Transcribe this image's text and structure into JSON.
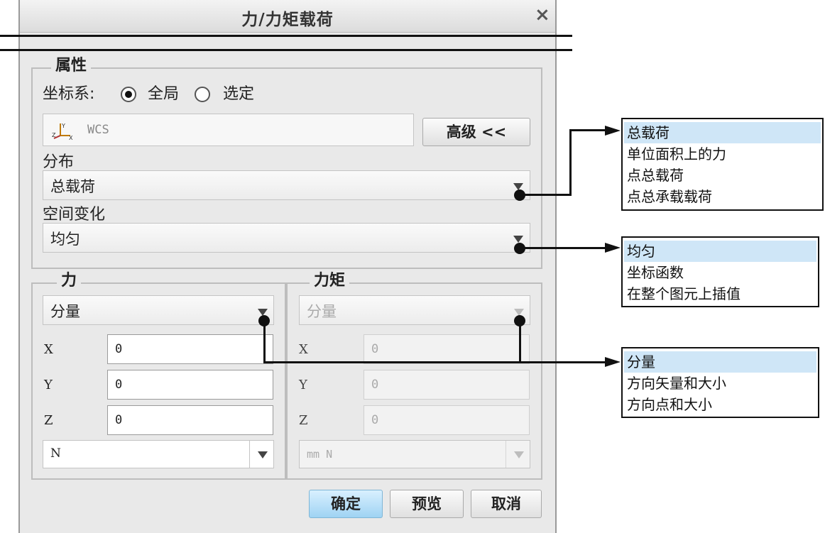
{
  "dialog": {
    "title": "力/力矩载荷",
    "close_glyph": "×",
    "properties": {
      "group_label": "属性",
      "coord_label": "坐标系:",
      "radio_global": "全局",
      "radio_selected": "选定",
      "coord_value": "WCS",
      "advanced_button": "高级 <<",
      "distribution_label": "分布",
      "distribution_value": "总载荷",
      "spatial_label": "空间变化",
      "spatial_value": "均匀"
    },
    "force": {
      "group_label": "力",
      "mode_value": "分量",
      "x_label": "X",
      "x_value": "0",
      "y_label": "Y",
      "y_value": "0",
      "z_label": "Z",
      "z_value": "0",
      "unit_value": "N"
    },
    "moment": {
      "group_label": "力矩",
      "mode_value": "分量",
      "x_label": "X",
      "x_value": "0",
      "y_label": "Y",
      "y_value": "0",
      "z_label": "Z",
      "z_value": "0",
      "unit_value": "mm N"
    },
    "buttons": {
      "ok": "确定",
      "preview": "预览",
      "cancel": "取消"
    }
  },
  "callouts": {
    "distribution_options": [
      "总载荷",
      "单位面积上的力",
      "点总载荷",
      "点总承载载荷"
    ],
    "spatial_options": [
      "均匀",
      "坐标函数",
      "在整个图元上插值"
    ],
    "component_options": [
      "分量",
      "方向矢量和大小",
      "方向点和大小"
    ]
  },
  "colors": {
    "dialog_bg": "#e9e9e9",
    "selected_item": "#cfe6f7",
    "primary_button": "#9fd3f3"
  }
}
